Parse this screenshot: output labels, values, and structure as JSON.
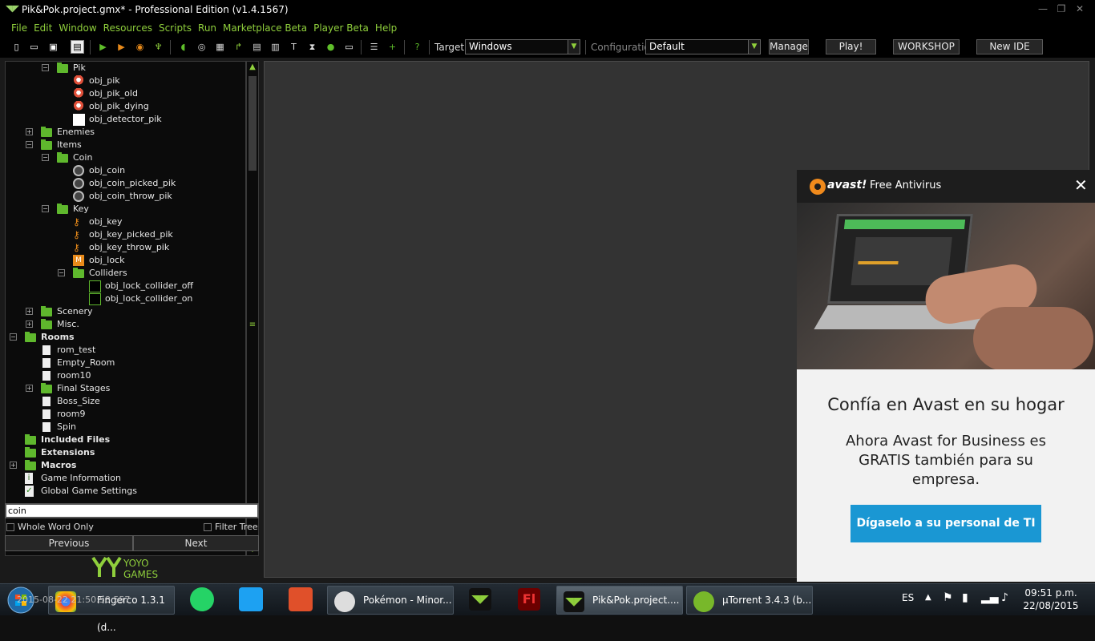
{
  "window": {
    "title": "Pik&Pok.project.gmx*  -  Professional Edition (v1.4.1567)"
  },
  "menu": [
    "File",
    "Edit",
    "Window",
    "Resources",
    "Scripts",
    "Run",
    "Marketplace Beta",
    "Player Beta",
    "Help"
  ],
  "toolbar": {
    "target_label": "Target:",
    "target_value": "Windows",
    "config_label": "Configuration:",
    "config_value": "Default",
    "manage": "Manage",
    "play": "Play!",
    "workshop": "WORKSHOP",
    "new_ide": "New IDE"
  },
  "tree": [
    {
      "label": "Pik",
      "expander": "minus",
      "icon": "folder-icon"
    },
    {
      "label": "obj_pik",
      "icon": "sprite-icon"
    },
    {
      "label": "obj_pik_old",
      "icon": "sprite-icon"
    },
    {
      "label": "obj_pik_dying",
      "icon": "sprite-icon"
    },
    {
      "label": "obj_detector_pik",
      "icon": "white-box-icon"
    },
    {
      "label": "Enemies",
      "expander": "plus",
      "icon": "folder-icon"
    },
    {
      "label": "Items",
      "expander": "minus",
      "icon": "folder-icon"
    },
    {
      "label": "Coin",
      "expander": "minus",
      "icon": "folder-icon"
    },
    {
      "label": "obj_coin",
      "icon": "coin-icon"
    },
    {
      "label": "obj_coin_picked_pik",
      "icon": "coin-icon"
    },
    {
      "label": "obj_coin_throw_pik",
      "icon": "coin-icon"
    },
    {
      "label": "Key",
      "expander": "minus",
      "icon": "folder-icon"
    },
    {
      "label": "obj_key",
      "icon": "key-icon"
    },
    {
      "label": "obj_key_picked_pik",
      "icon": "key-icon"
    },
    {
      "label": "obj_key_throw_pik",
      "icon": "key-icon"
    },
    {
      "label": "obj_lock",
      "icon": "lock-icon"
    },
    {
      "label": "Colliders",
      "expander": "minus",
      "icon": "folder-icon"
    },
    {
      "label": "obj_lock_collider_off",
      "icon": "collider-icon"
    },
    {
      "label": "obj_lock_collider_on",
      "icon": "collider-icon"
    },
    {
      "label": "Scenery",
      "expander": "plus",
      "icon": "folder-icon"
    },
    {
      "label": "Misc.",
      "expander": "plus",
      "icon": "folder-icon"
    },
    {
      "label": "Rooms",
      "expander": "minus",
      "icon": "folder-icon",
      "bold": true
    },
    {
      "label": "rom_test",
      "icon": "room-icon"
    },
    {
      "label": "Empty_Room",
      "icon": "room-icon"
    },
    {
      "label": "room10",
      "icon": "room-icon"
    },
    {
      "label": "Final Stages",
      "expander": "plus",
      "icon": "folder-icon"
    },
    {
      "label": "Boss_Size",
      "icon": "room-icon"
    },
    {
      "label": "room9",
      "icon": "room-icon"
    },
    {
      "label": "Spin",
      "icon": "room-icon"
    },
    {
      "label": "Included Files",
      "icon": "folder-icon",
      "bold": true
    },
    {
      "label": "Extensions",
      "icon": "folder-icon",
      "bold": true
    },
    {
      "label": "Macros",
      "expander": "plus",
      "icon": "folder-icon",
      "bold": true
    },
    {
      "label": "Game Information",
      "icon": "info-icon"
    },
    {
      "label": "Global Game Settings",
      "icon": "settings-check-icon"
    }
  ],
  "search": {
    "value": "coin",
    "whole_word": "Whole Word Only",
    "filter_tree": "Filter Tree",
    "previous": "Previous",
    "next": "Next"
  },
  "brand": {
    "logo_text": "YOYO\nGAMES"
  },
  "avast": {
    "brand": "avast!",
    "product": "Free Antivirus",
    "headline": "Confía en Avast en su hogar",
    "body": "Ahora Avast for Business es GRATIS también para su empresa.",
    "cta": "Dígaselo a su personal de TI"
  },
  "taskbar": {
    "items": [
      {
        "label": "Fingerco 1.3.1 (d...",
        "overlay": "2015-08-22 21:50:58.557"
      },
      {
        "label": ""
      },
      {
        "label": ""
      },
      {
        "label": ""
      },
      {
        "label": "Pokémon - Minor..."
      },
      {
        "label": ""
      },
      {
        "label": ""
      },
      {
        "label": "Pik&Pok.project...."
      },
      {
        "label": "µTorrent 3.4.3  (b..."
      }
    ],
    "lang": "ES",
    "time": "09:51 p.m.",
    "date": "22/08/2015"
  },
  "colors": {
    "accent": "#8fcf3c",
    "folder": "#5fb82d",
    "avast_cta": "#1a97d3"
  }
}
